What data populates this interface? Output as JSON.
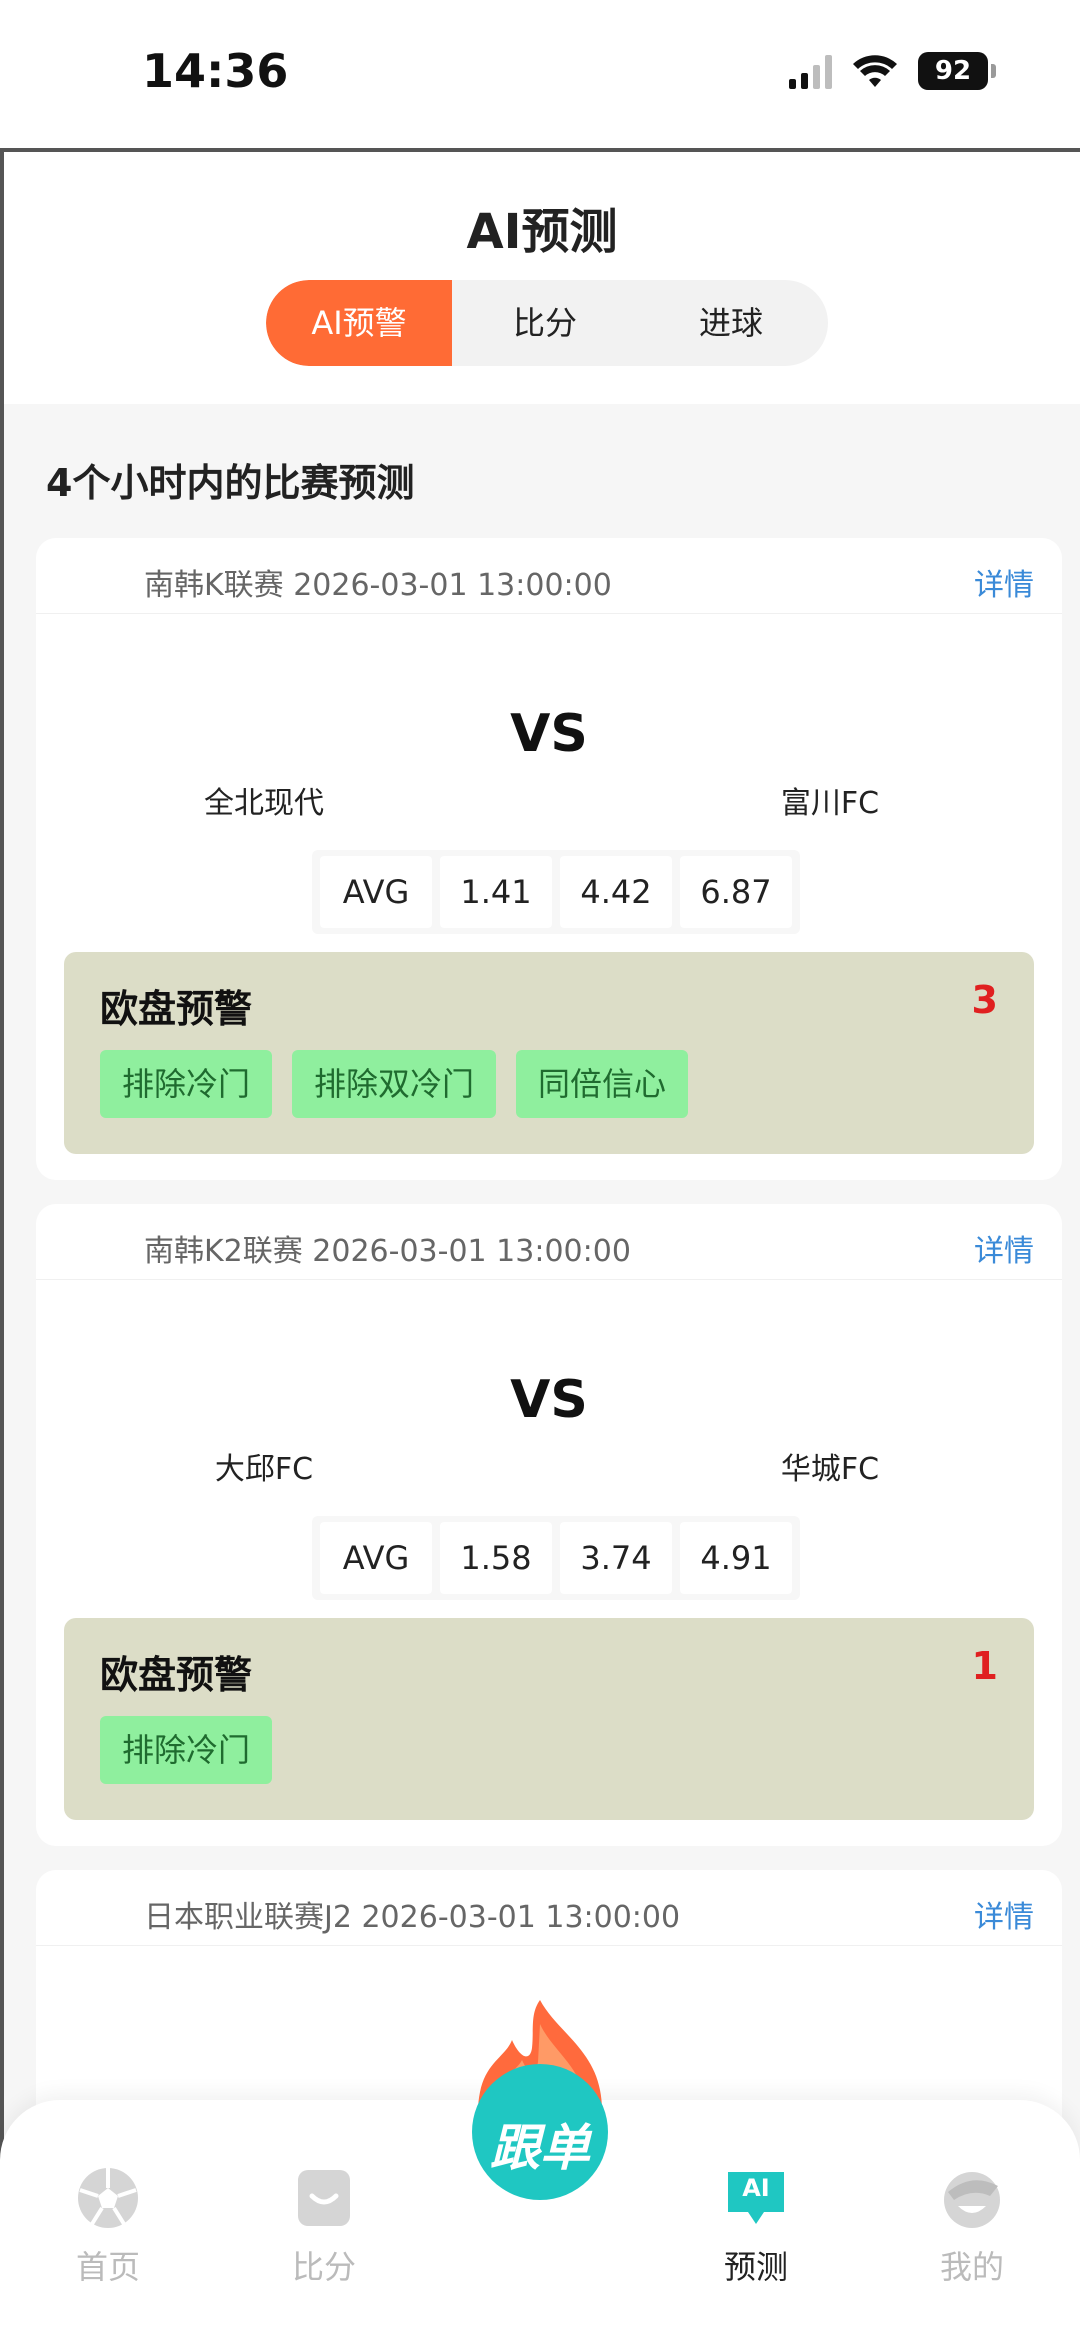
{
  "status_bar": {
    "time": "14:36",
    "battery": "92"
  },
  "header": {
    "title": "AI预测"
  },
  "segment_tabs": [
    {
      "label": "AI预警",
      "active": true
    },
    {
      "label": "比分",
      "active": false
    },
    {
      "label": "进球",
      "active": false
    }
  ],
  "section_title": "4个小时内的比赛预测",
  "matches": [
    {
      "league_time": "南韩K联赛 2026-03-01 13:00:00",
      "detail_label": "详情",
      "vs_label": "VS",
      "home": "全北现代",
      "away": "富川FC",
      "odds": [
        "AVG",
        "1.41",
        "4.42",
        "6.87"
      ],
      "alert_title": "欧盘预警",
      "alert_count": "3",
      "tags": [
        "排除冷门",
        "排除双冷门",
        "同倍信心"
      ]
    },
    {
      "league_time": "南韩K2联赛 2026-03-01 13:00:00",
      "detail_label": "详情",
      "vs_label": "VS",
      "home": "大邱FC",
      "away": "华城FC",
      "odds": [
        "AVG",
        "1.58",
        "3.74",
        "4.91"
      ],
      "alert_title": "欧盘预警",
      "alert_count": "1",
      "tags": [
        "排除冷门"
      ]
    },
    {
      "league_time": "日本职业联赛J2 2026-03-01 13:00:00",
      "detail_label": "详情"
    }
  ],
  "bottom_nav": {
    "items": [
      {
        "label": "首页",
        "icon": "soccer-ball-icon",
        "active": false
      },
      {
        "label": "比分",
        "icon": "score-bag-icon",
        "active": false
      },
      {
        "label": "预测",
        "icon": "ai-chat-icon",
        "active": true
      },
      {
        "label": "我的",
        "icon": "profile-face-icon",
        "active": false
      }
    ],
    "center_button": "跟单",
    "ai_badge": "AI"
  },
  "colors": {
    "accent_orange": "#ff6b35",
    "link_blue": "#3a8ad8",
    "alert_bg": "#dcddc7",
    "tag_green": "#8fef9e",
    "count_red": "#e02020",
    "center_teal": "#1fc7c2"
  }
}
